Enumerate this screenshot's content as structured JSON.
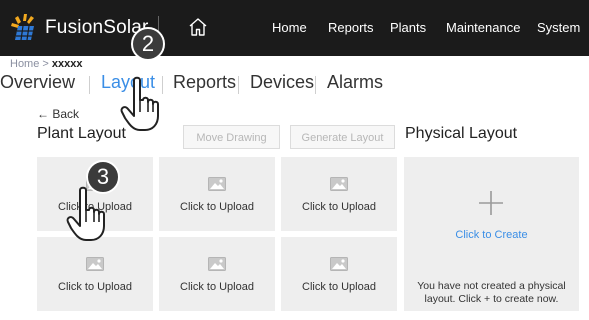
{
  "header": {
    "brand": "FusionSolar",
    "nav": [
      "Home",
      "Reports",
      "Plants",
      "Maintenance",
      "System"
    ]
  },
  "breadcrumb": {
    "root": "Home",
    "separator": ">",
    "current": "xxxxx"
  },
  "tabs": [
    {
      "label": "Overview",
      "active": false
    },
    {
      "label": "Layout",
      "active": true
    },
    {
      "label": "Reports",
      "active": false
    },
    {
      "label": "Devices",
      "active": false
    },
    {
      "label": "Alarms",
      "active": false
    }
  ],
  "back_label": "← Back",
  "plant_layout": {
    "title": "Plant Layout",
    "move_drawing": "Move Drawing",
    "generate_layout": "Generate Layout",
    "tiles": [
      "Click to Upload",
      "Click to Upload",
      "Click to Upload",
      "Click to Upload",
      "Click to Upload",
      "Click to Upload"
    ]
  },
  "physical_layout": {
    "title": "Physical Layout",
    "create_label": "Click to Create",
    "empty_message": "You have not created a physical layout. Click + to create now."
  },
  "steps": [
    "2",
    "3"
  ],
  "colors": {
    "topbar": "#1b1b1b",
    "accent": "#3a8ee6",
    "tile": "#eeeeee"
  },
  "icons": [
    "fusionsolar-logo-icon",
    "home-icon",
    "image-icon",
    "plus-icon",
    "pointing-hand-icon"
  ]
}
